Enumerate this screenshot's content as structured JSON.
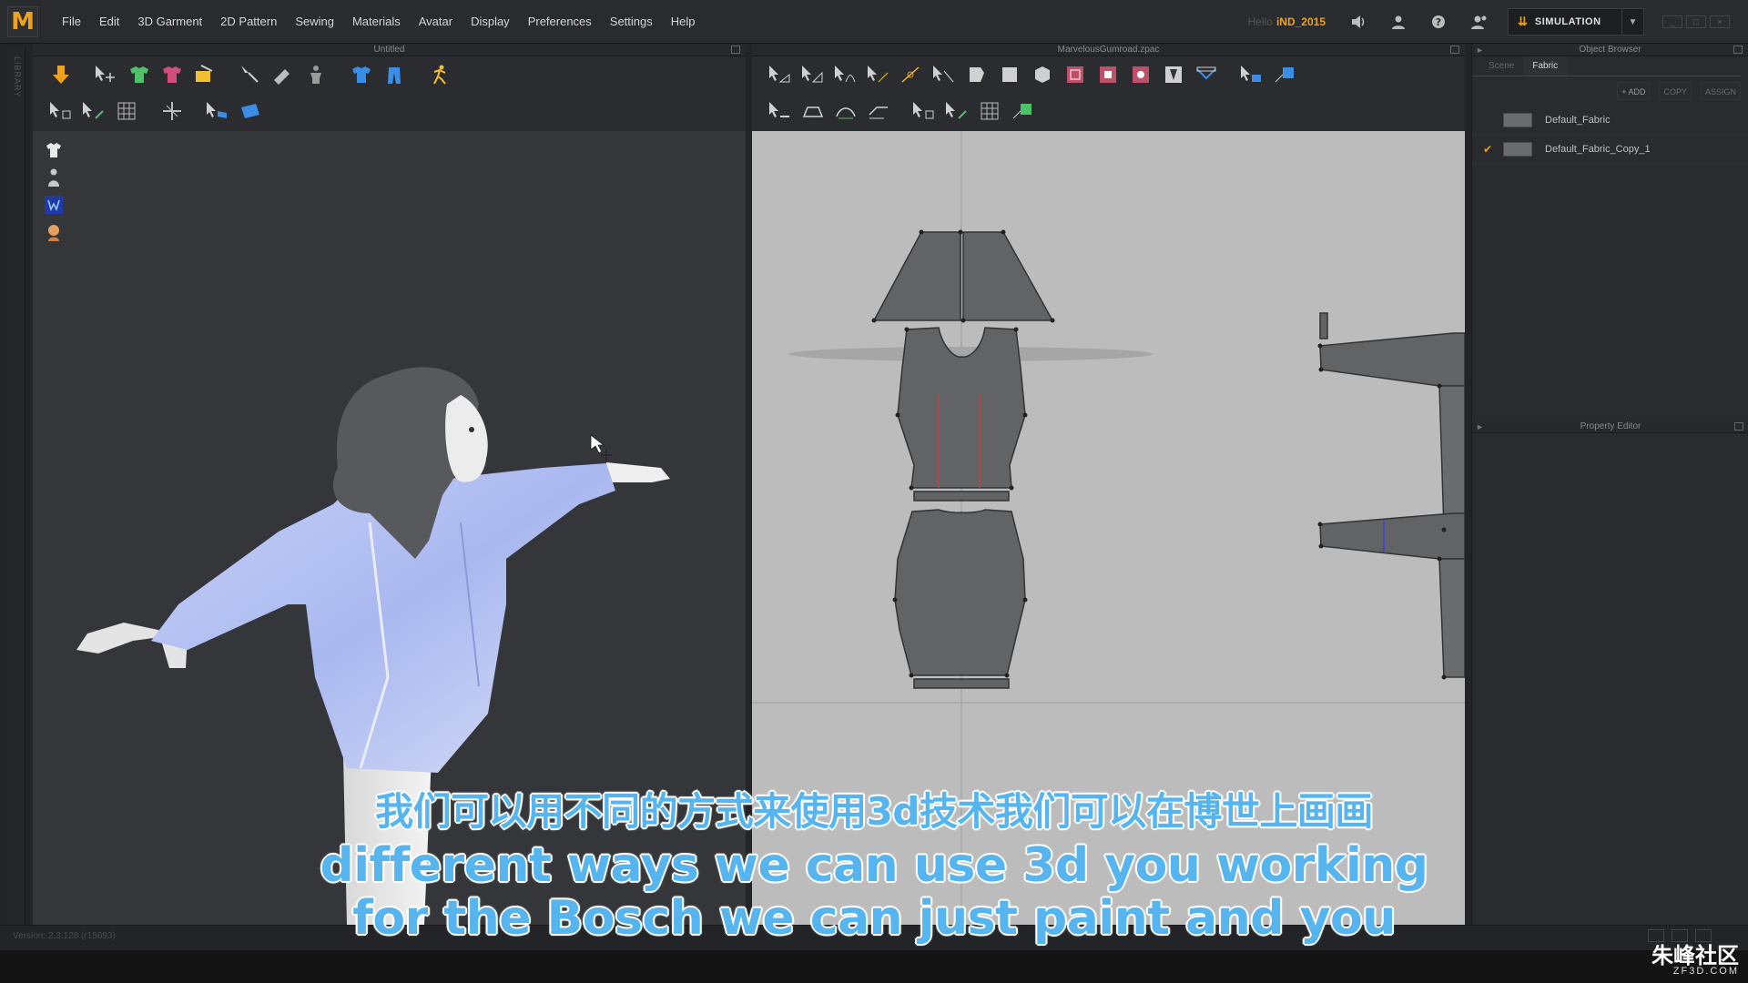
{
  "app": {
    "logo": "M"
  },
  "menu": [
    "File",
    "Edit",
    "3D Garment",
    "2D Pattern",
    "Sewing",
    "Materials",
    "Avatar",
    "Display",
    "Preferences",
    "Settings",
    "Help"
  ],
  "user": {
    "greeting": "Hello",
    "name": "iND_2015"
  },
  "simulation": {
    "label": "SIMULATION"
  },
  "side_strip": {
    "label": "LIBRARY"
  },
  "panel3d": {
    "title": "Untitled"
  },
  "panel2d": {
    "title": "MarvelousGumroad.zpac"
  },
  "object_browser": {
    "title": "Object Browser",
    "tabs": [
      "Scene",
      "Fabric"
    ],
    "active_tab": "Fabric",
    "actions": [
      "+ ADD",
      "COPY",
      "ASSIGN"
    ],
    "fabrics": [
      {
        "name": "Default_Fabric",
        "checked": false
      },
      {
        "name": "Default_Fabric_Copy_1",
        "checked": true
      }
    ]
  },
  "property_editor": {
    "title": "Property Editor"
  },
  "status": {
    "version": "Version: 2.3.128   (r15693)"
  },
  "subtitles": {
    "line_cn": "我们可以用不同的方式来使用3d技术我们可以在博世上画画",
    "line_en1": "different ways we can use 3d you working",
    "line_en2": "for the Bosch we can just paint and you"
  },
  "watermark": {
    "line1": "朱峰社区",
    "line2": "ZF3D.COM"
  },
  "colors": {
    "accent": "#f0a21a",
    "garment": "#b9c6f2",
    "pattern_piece": "#626365",
    "pattern_bg": "#bcbcbc",
    "subtitle": "#56b4ef"
  }
}
